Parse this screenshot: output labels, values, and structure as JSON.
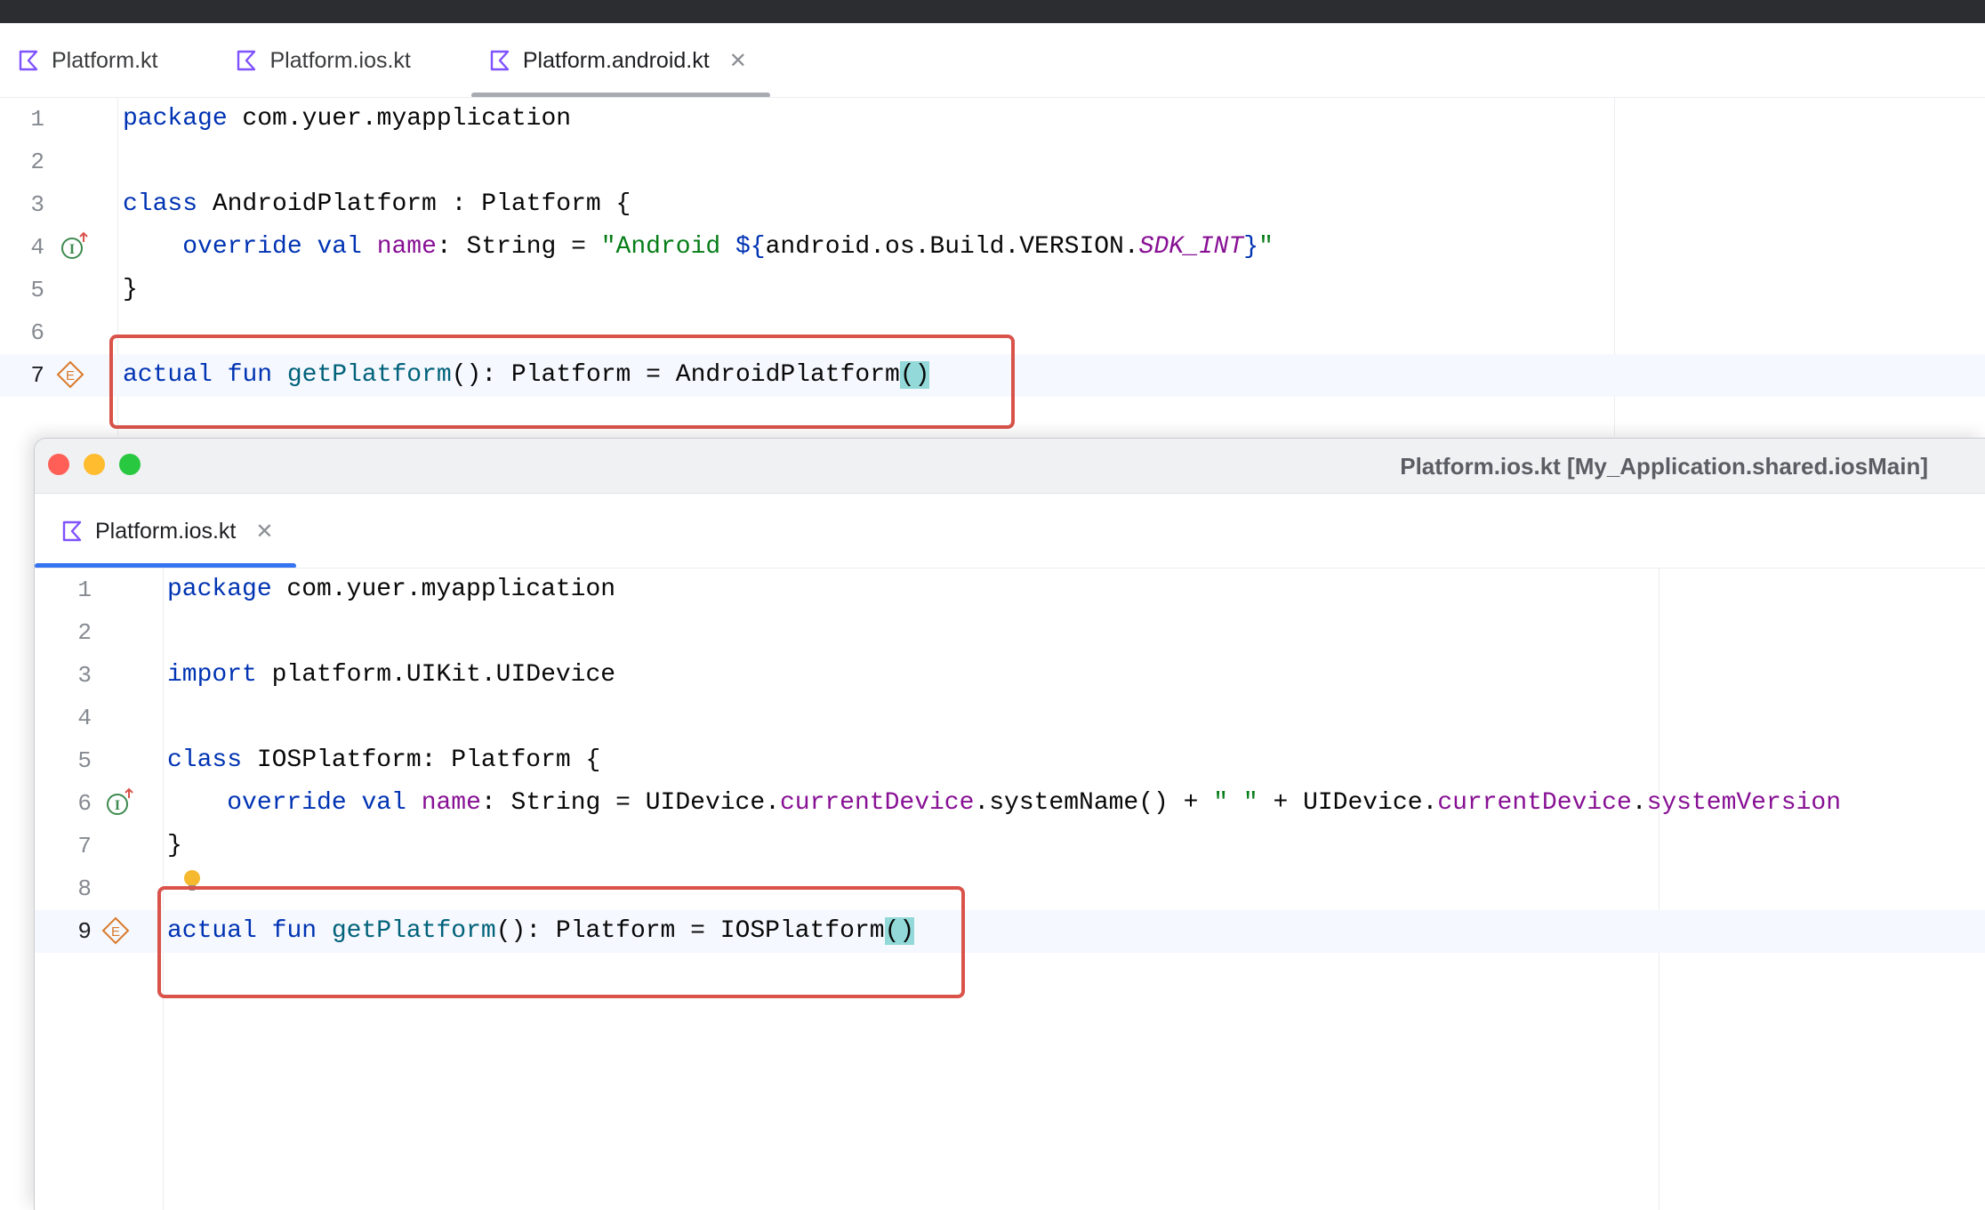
{
  "main_editor": {
    "tabs": [
      {
        "label": "Platform.kt",
        "active": false
      },
      {
        "label": "Platform.ios.kt",
        "active": false
      },
      {
        "label": "Platform.android.kt",
        "active": true,
        "closable": true
      }
    ],
    "line_numbers": [
      "1",
      "2",
      "3",
      "4",
      "5",
      "6",
      "7"
    ],
    "current_line": "7",
    "gutter_markers": {
      "line4": "implements-icon",
      "line7": "expect-actual-icon"
    },
    "code": {
      "l1_kw": "package",
      "l1_rest": " com.yuer.myapplication",
      "l3_kw": "class",
      "l3_rest": " AndroidPlatform : Platform {",
      "l4_kw1": "override",
      "l4_kw2": "val",
      "l4_prop": "name",
      "l4_mid": ": String = ",
      "l4_str1": "\"Android ",
      "l4_tpl_open": "${",
      "l4_expr": "android.os.Build.VERSION.",
      "l4_sdk": "SDK_INT",
      "l4_tpl_close": "}",
      "l4_str2": "\"",
      "l5": "}",
      "l7_kw1": "actual",
      "l7_kw2": "fun",
      "l7_fn": "getPlatform",
      "l7_mid": "(): Platform = AndroidPlatform",
      "l7_paren": "()"
    }
  },
  "popup_window": {
    "title": "Platform.ios.kt [My_Application.shared.iosMain]",
    "traffic_lights": {
      "close": "#ff5f57",
      "minimize": "#febc2e",
      "zoom": "#28c840"
    },
    "tab": {
      "label": "Platform.ios.kt",
      "closable": true
    },
    "line_numbers": [
      "1",
      "2",
      "3",
      "4",
      "5",
      "6",
      "7",
      "8",
      "9"
    ],
    "current_line": "9",
    "gutter_markers": {
      "line6": "implements-icon",
      "line8": "lightbulb-icon",
      "line9": "expect-actual-icon"
    },
    "code": {
      "l1_kw": "package",
      "l1_rest": " com.yuer.myapplication",
      "l3_kw": "import",
      "l3_rest": " platform.UIKit.UIDevice",
      "l5_kw": "class",
      "l5_rest": " IOSPlatform: Platform {",
      "l6_kw1": "override",
      "l6_kw2": "val",
      "l6_prop": "name",
      "l6_a": ": String = UIDevice.",
      "l6_cd1": "currentDevice",
      "l6_b": ".systemName() + ",
      "l6_str": "\" \"",
      "l6_c": " + UIDevice.",
      "l6_cd2": "currentDevice",
      "l6_d": ".",
      "l6_sv": "systemVersion",
      "l7": "}",
      "l9_kw1": "actual",
      "l9_kw2": "fun",
      "l9_fn": "getPlatform",
      "l9_mid": "(): Platform = IOSPlatform",
      "l9_paren": "()"
    }
  },
  "colors": {
    "accent_underline": "#3574f0",
    "inactive_underline": "#a8abb2",
    "highlight_box": "#d9534a",
    "kotlin_icon": "#7f52ff"
  }
}
